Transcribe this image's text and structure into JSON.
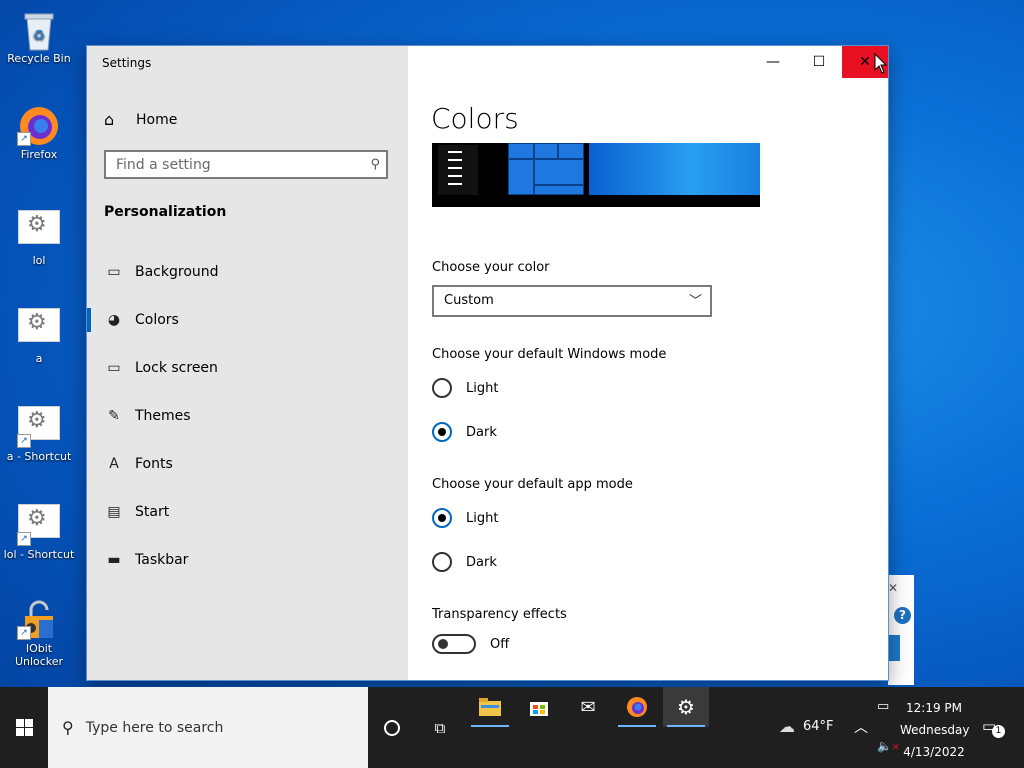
{
  "desktop": {
    "icons": [
      {
        "label": "Recycle Bin"
      },
      {
        "label": "Firefox"
      },
      {
        "label": "lol"
      },
      {
        "label": "a"
      },
      {
        "label": "a - Shortcut"
      },
      {
        "label": "lol - Shortcut"
      },
      {
        "label": "IObit Unlocker"
      }
    ]
  },
  "window": {
    "title": "Settings",
    "controls": {
      "minimize": "—",
      "maximize": "☐",
      "close": "✕"
    }
  },
  "nav": {
    "home_label": "Home",
    "search_placeholder": "Find a setting",
    "section_title": "Personalization",
    "items": [
      {
        "label": "Background",
        "icon": "picture-icon",
        "glyph": "▭"
      },
      {
        "label": "Colors",
        "icon": "palette-icon",
        "glyph": "🎨"
      },
      {
        "label": "Lock screen",
        "icon": "lock-screen-icon",
        "glyph": "▭"
      },
      {
        "label": "Themes",
        "icon": "brush-icon",
        "glyph": "✎"
      },
      {
        "label": "Fonts",
        "icon": "fonts-icon",
        "glyph": "A"
      },
      {
        "label": "Start",
        "icon": "start-icon",
        "glyph": "▤"
      },
      {
        "label": "Taskbar",
        "icon": "taskbar-icon",
        "glyph": "▬"
      }
    ],
    "active_item": "Colors"
  },
  "content": {
    "title": "Colors",
    "choose_color_label": "Choose your color",
    "choose_color_value": "Custom",
    "windows_mode_label": "Choose your default Windows mode",
    "windows_mode_options": [
      "Light",
      "Dark"
    ],
    "windows_mode_selected": "Dark",
    "app_mode_label": "Choose your default app mode",
    "app_mode_options": [
      "Light",
      "Dark"
    ],
    "app_mode_selected": "Light",
    "transparency_label": "Transparency effects",
    "transparency_value": "Off"
  },
  "taskbar": {
    "search_placeholder": "Type here to search",
    "weather_temp": "64°F",
    "time": "12:19 PM",
    "day": "Wednesday",
    "date": "4/13/2022",
    "notification_count": "1"
  },
  "colors": {
    "accent": "#0067c0",
    "close_hover": "#e81123",
    "nav_bg": "#e6e6e6",
    "taskbar_bg": "#1f1f1f"
  }
}
